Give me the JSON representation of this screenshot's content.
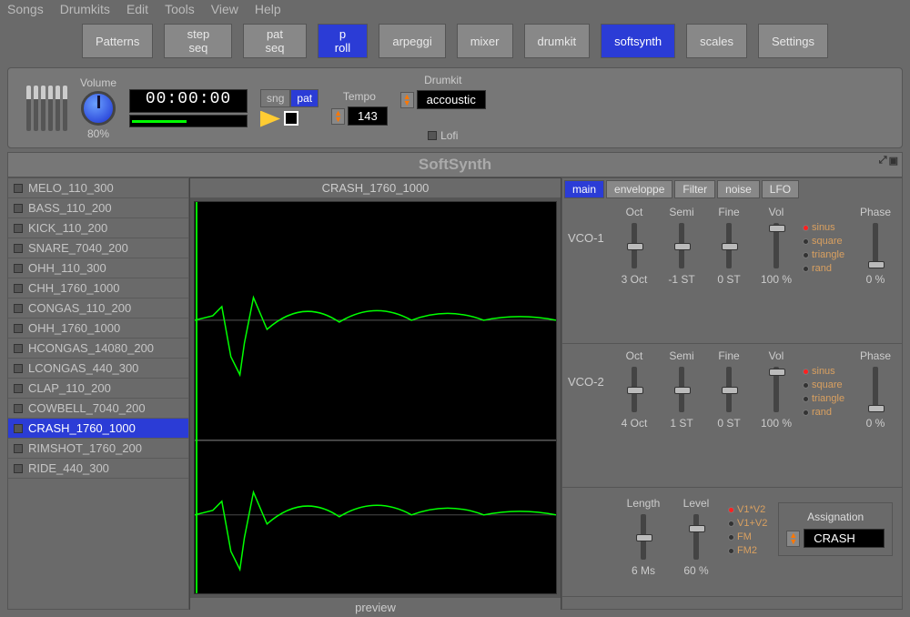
{
  "menubar": [
    "Songs",
    "Drumkits",
    "Edit",
    "Tools",
    "View",
    "Help"
  ],
  "toolbar": [
    {
      "label": "Patterns",
      "active": false
    },
    {
      "label": "step seq",
      "active": false
    },
    {
      "label": "pat seq",
      "active": false
    },
    {
      "label": "p roll",
      "active": true
    },
    {
      "label": "arpeggi",
      "active": false
    },
    {
      "label": "mixer",
      "active": false
    },
    {
      "label": "drumkit",
      "active": false
    },
    {
      "label": "softsynth",
      "active": true
    },
    {
      "label": "scales",
      "active": false
    },
    {
      "label": "Settings",
      "active": false
    }
  ],
  "transport": {
    "volume_label": "Volume",
    "volume_pct": "80%",
    "timecode": "00:00:00",
    "sng": "sng",
    "pat": "pat",
    "tempo_label": "Tempo",
    "tempo": "143",
    "drumkit_label": "Drumkit",
    "drumkit": "accoustic",
    "lofi": "Lofi"
  },
  "section_title": "SoftSynth",
  "samples": [
    "MELO_110_300",
    "BASS_110_200",
    "KICK_110_200",
    "SNARE_7040_200",
    "OHH_110_300",
    "CHH_1760_1000",
    "CONGAS_110_200",
    "OHH_1760_1000",
    "HCONGAS_14080_200",
    "LCONGAS_440_300",
    "CLAP_110_200",
    "COWBELL_7040_200",
    "CRASH_1760_1000",
    "RIMSHOT_1760_200",
    "RIDE_440_300"
  ],
  "selected_sample": "CRASH_1760_1000",
  "wave": {
    "title": "CRASH_1760_1000",
    "footer": "preview"
  },
  "synth": {
    "tabs": [
      "main",
      "enveloppe",
      "Filter",
      "noise",
      "LFO"
    ],
    "active_tab": "main",
    "vco1": {
      "name": "VCO-1",
      "oct": {
        "label": "Oct",
        "val": "3 Oct"
      },
      "semi": {
        "label": "Semi",
        "val": "-1 ST"
      },
      "fine": {
        "label": "Fine",
        "val": "0 ST"
      },
      "vol": {
        "label": "Vol",
        "val": "100 %"
      },
      "phase": {
        "label": "Phase",
        "val": "0 %"
      },
      "waves": [
        "sinus",
        "square",
        "triangle",
        "rand"
      ]
    },
    "vco2": {
      "name": "VCO-2",
      "oct": {
        "label": "Oct",
        "val": "4 Oct"
      },
      "semi": {
        "label": "Semi",
        "val": "1 ST"
      },
      "fine": {
        "label": "Fine",
        "val": "0 ST"
      },
      "vol": {
        "label": "Vol",
        "val": "100 %"
      },
      "phase": {
        "label": "Phase",
        "val": "0 %"
      },
      "waves": [
        "sinus",
        "square",
        "triangle",
        "rand"
      ]
    },
    "mix": {
      "length": {
        "label": "Length",
        "val": "6 Ms"
      },
      "level": {
        "label": "Level",
        "val": "60 %"
      },
      "modes": [
        "V1*V2",
        "V1+V2",
        "FM",
        "FM2"
      ]
    },
    "assign": {
      "title": "Assignation",
      "value": "CRASH"
    }
  }
}
